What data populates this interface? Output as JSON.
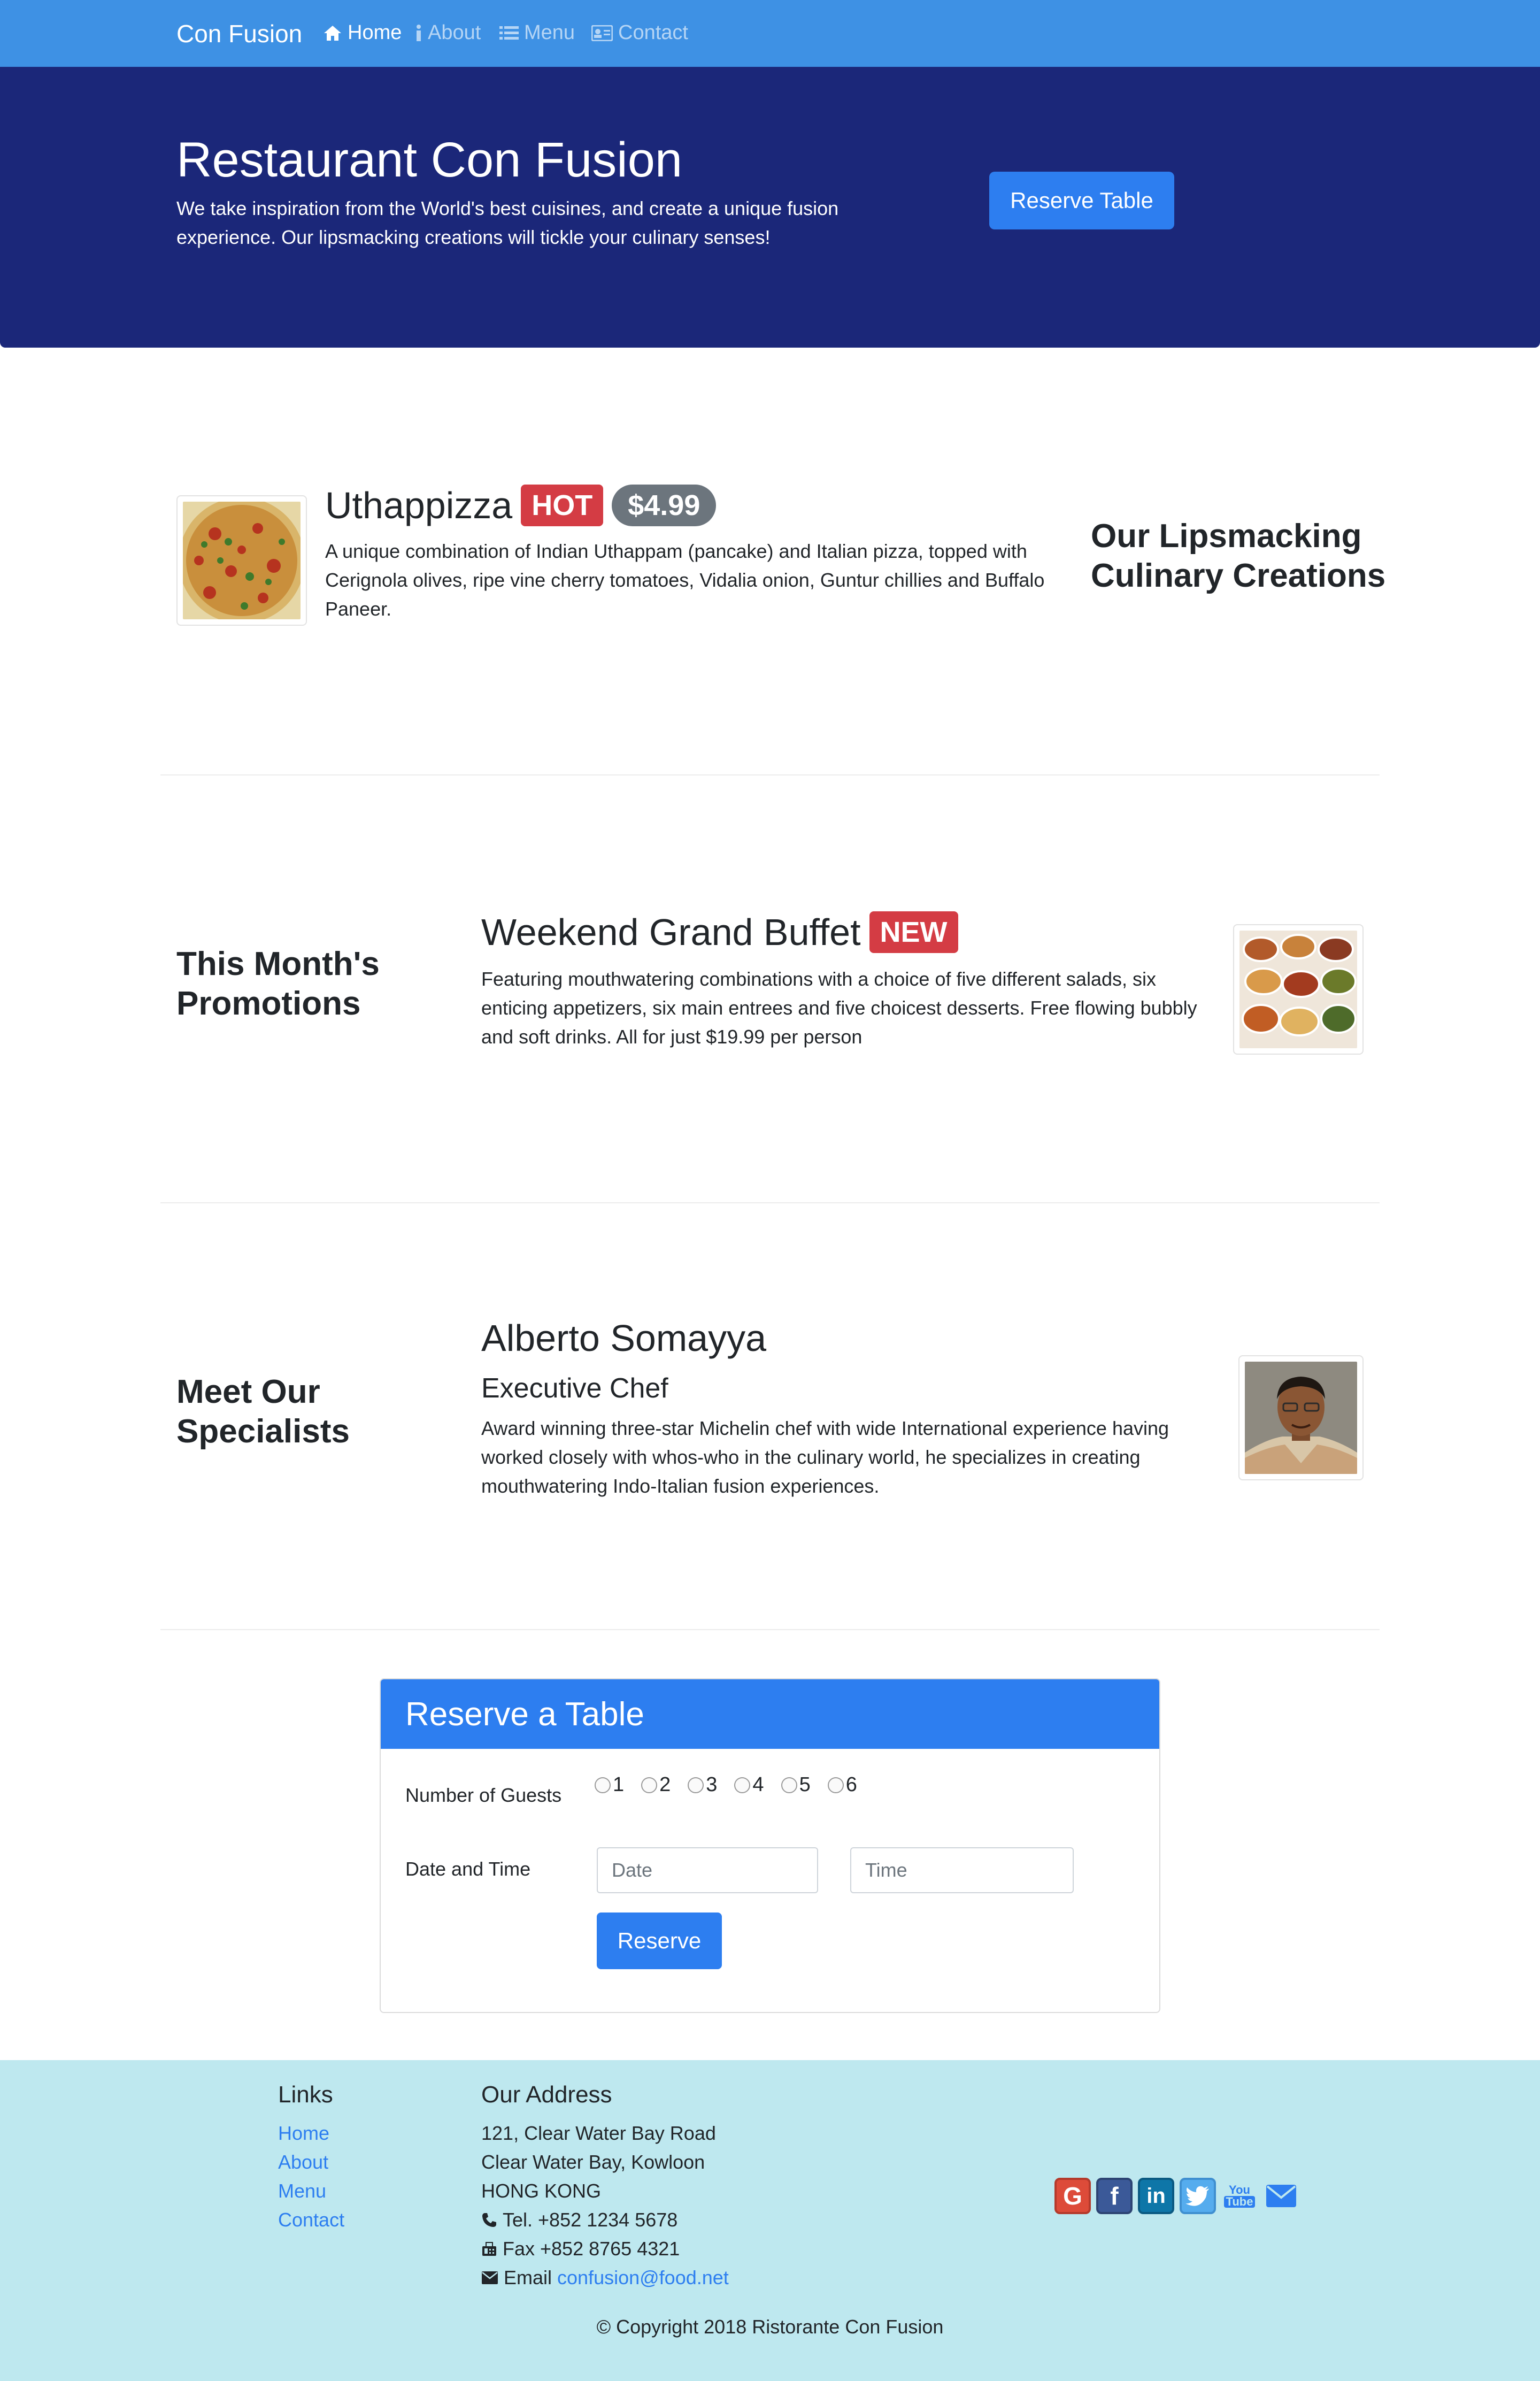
{
  "nav": {
    "brand": "Con Fusion",
    "items": [
      {
        "label": "Home",
        "icon": "home-icon",
        "active": true
      },
      {
        "label": "About",
        "icon": "info-icon",
        "active": false
      },
      {
        "label": "Menu",
        "icon": "list-icon",
        "active": false
      },
      {
        "label": "Contact",
        "icon": "address-card-icon",
        "active": false
      }
    ]
  },
  "jumbotron": {
    "title": "Restaurant Con Fusion",
    "text": "We take inspiration from the World's best cuisines, and create a unique fusion experience. Our lipsmacking creations will tickle your culinary senses!",
    "button": "Reserve Table"
  },
  "dish": {
    "name": "Uthappizza",
    "badge": "HOT",
    "price": "$4.99",
    "description": "A unique combination of Indian Uthappam (pancake) and Italian pizza, topped with Cerignola olives, ripe vine cherry tomatoes, Vidalia onion, Guntur chillies and Buffalo Paneer.",
    "side_title": "Our Lipsmacking Culinary Creations"
  },
  "promotion": {
    "side_title": "This Month's Promotions",
    "name": "Weekend Grand Buffet",
    "badge": "NEW",
    "description": "Featuring mouthwatering combinations with a choice of five different salads, six enticing appetizers, six main entrees and five choicest desserts. Free flowing bubbly and soft drinks. All for just $19.99 per person"
  },
  "leader": {
    "side_title": "Meet Our Specialists",
    "name": "Alberto Somayya",
    "role": "Executive Chef",
    "description": "Award winning three-star Michelin chef with wide International experience having worked closely with whos-who in the culinary world, he specializes in creating mouthwatering Indo-Italian fusion experiences."
  },
  "reserve_form": {
    "title": "Reserve a Table",
    "guests_label": "Number of Guests",
    "guest_options": [
      "1",
      "2",
      "3",
      "4",
      "5",
      "6"
    ],
    "datetime_label": "Date and Time",
    "date_placeholder": "Date",
    "time_placeholder": "Time",
    "submit": "Reserve"
  },
  "footer": {
    "links_title": "Links",
    "links": [
      "Home",
      "About",
      "Menu",
      "Contact"
    ],
    "address_title": "Our Address",
    "address_lines": [
      "121, Clear Water Bay Road",
      "Clear Water Bay, Kowloon",
      "HONG KONG"
    ],
    "tel": "Tel. +852 1234 5678",
    "fax": "Fax +852 8765 4321",
    "email_label": "Email",
    "email": "confusion@food.net",
    "social": [
      "google-plus-icon",
      "facebook-icon",
      "linkedin-icon",
      "twitter-icon",
      "youtube-icon",
      "envelope-icon"
    ],
    "copyright": "© Copyright 2018 Ristorante Con Fusion"
  },
  "colors": {
    "navbar": "#3e91e4",
    "jumbotron": "#1b2779",
    "primary": "#2d7ef0",
    "danger": "#d43c44",
    "footer": "#bee8ef"
  }
}
